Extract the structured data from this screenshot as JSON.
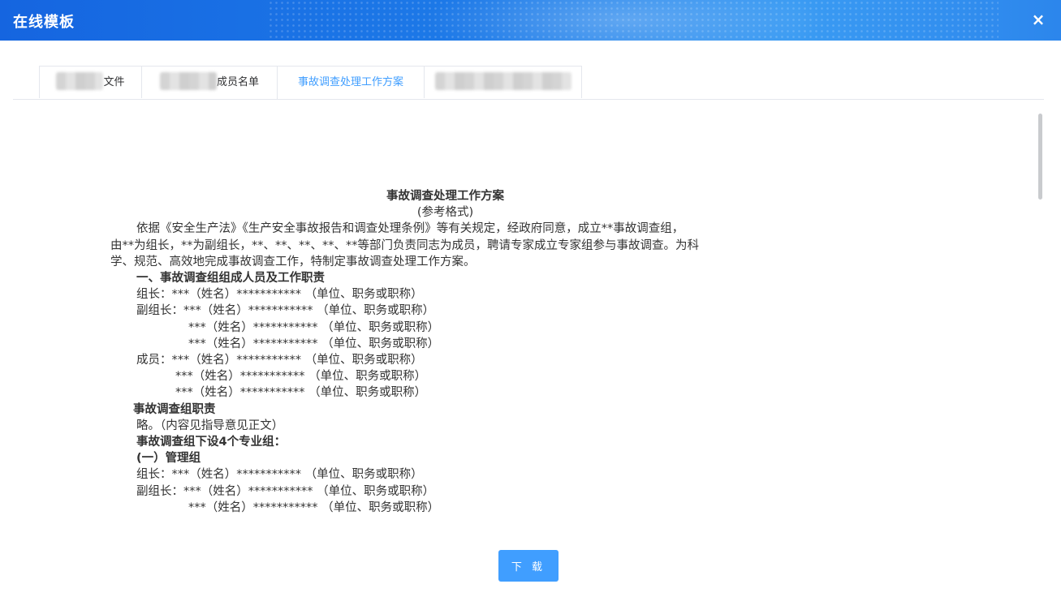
{
  "dialog": {
    "title": "在线模板",
    "close_icon": "×"
  },
  "tabs": [
    {
      "label": "文件",
      "redacted": true
    },
    {
      "label": "成员名单",
      "redacted": true
    },
    {
      "label": "事故调查处理工作方案",
      "active": true
    },
    {
      "label": "",
      "redacted": true
    }
  ],
  "document": {
    "title": "事故调查处理工作方案",
    "subtitle": "(参考格式)",
    "lines": [
      "依据《安全生产法》《生产安全事故报告和调查处理条例》等有关规定，经政府同意，成立**事故调查组，",
      "由**为组长，**为副组长，**、**、**、**、**等部门负责同志为成员，聘请专家成立专家组参与事故调查。为科",
      "学、规范、高效地完成事故调查工作，特制定事故调查处理工作方案。",
      "一、事故调查组组成人员及工作职责",
      "组长：***（姓名）*********** （单位、职务或职称）",
      "副组长：***（姓名）*********** （单位、职务或职称）",
      "***（姓名）*********** （单位、职务或职称）",
      "***（姓名）*********** （单位、职务或职称）",
      "成员：***（姓名）*********** （单位、职务或职称）",
      "***（姓名）*********** （单位、职务或职称）",
      "***（姓名）*********** （单位、职务或职称）",
      "事故调查组职责",
      "略。（内容见指导意见正文）",
      "事故调查组下设4个专业组：",
      "(一）管理组",
      "组长：***（姓名）*********** （单位、职务或职称）",
      "副组长：***（姓名）*********** （单位、职务或职称）",
      "***（姓名）*********** （单位、职务或职称）"
    ]
  },
  "footer": {
    "download_label": "下 载"
  }
}
